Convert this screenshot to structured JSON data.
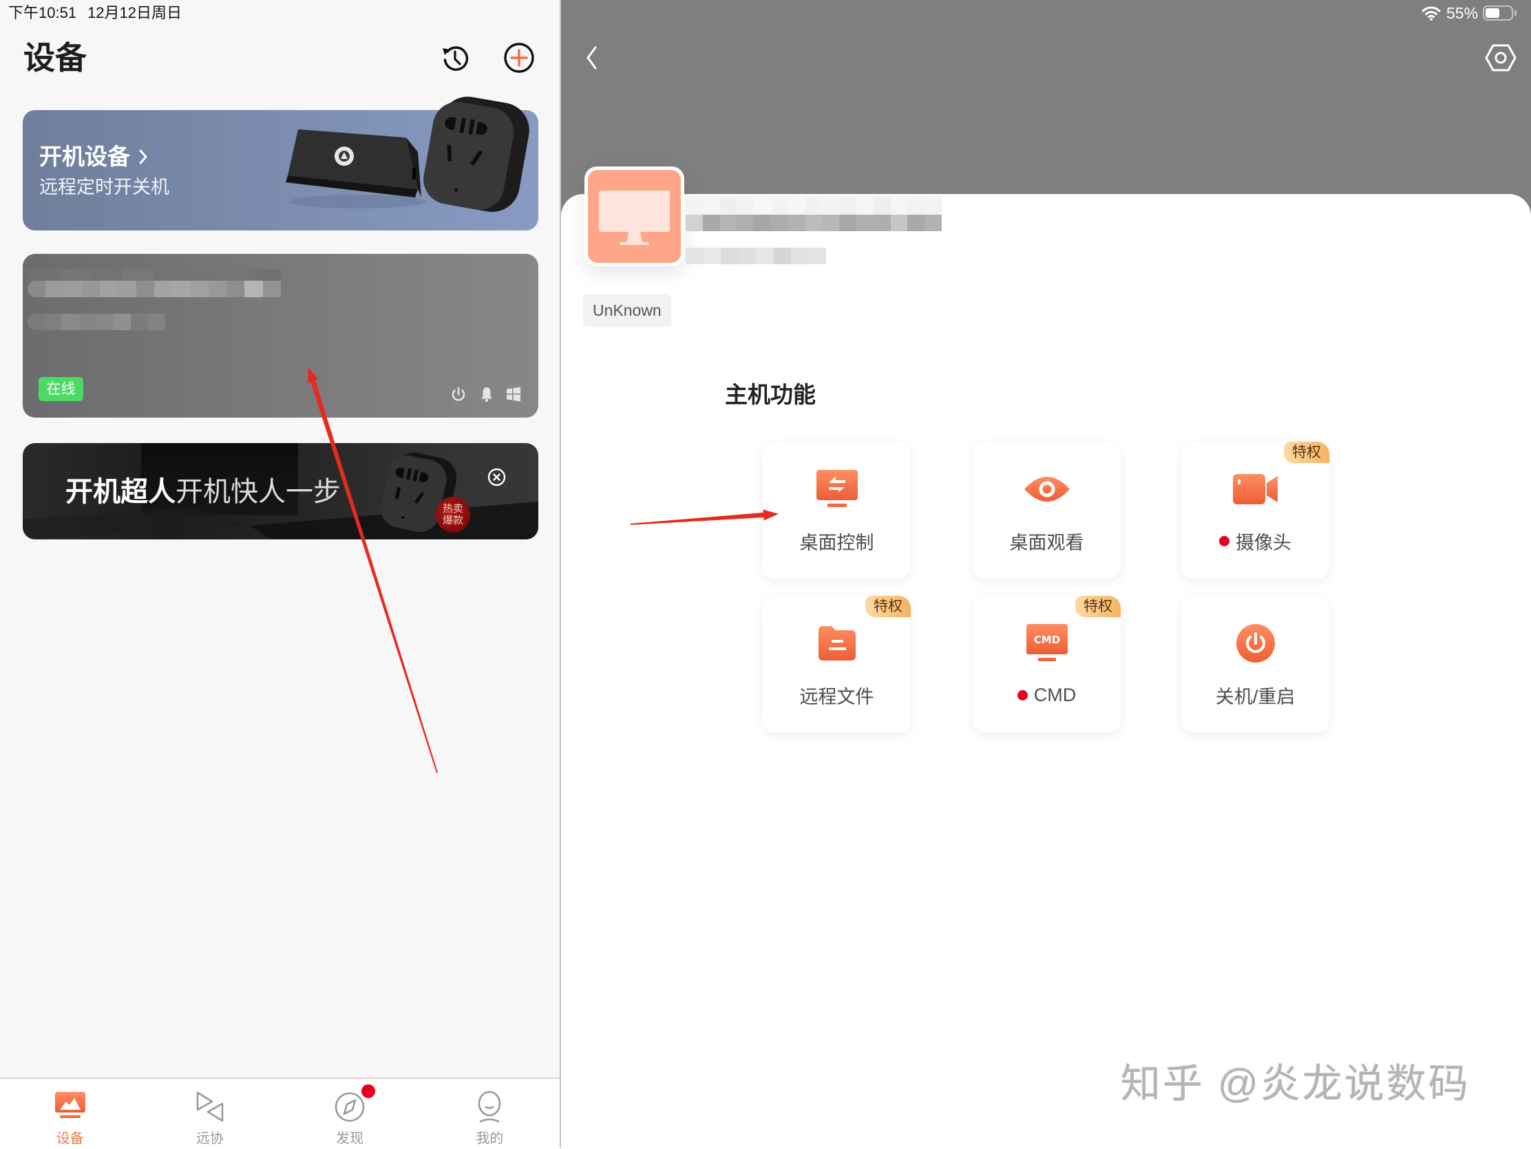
{
  "status_bar": {
    "time": "下午10:51",
    "date": "12月12日周日",
    "battery_text": "55%",
    "battery_level": 0.55
  },
  "devices_page": {
    "title": "设备",
    "banner": {
      "title": "开机设备",
      "subtitle": "远程定时开关机"
    },
    "device_card": {
      "status": "在线",
      "actions": [
        "power-icon",
        "bell-icon",
        "windows-icon"
      ]
    },
    "ad": {
      "title_bold": "开机超人",
      "title_light": "开机快人一步",
      "badge": [
        "热卖",
        "爆款"
      ]
    }
  },
  "tab_bar": {
    "tabs": [
      {
        "label": "设备",
        "icon": "device-icon",
        "active": true
      },
      {
        "label": "远协",
        "icon": "remote-assist-icon",
        "active": false
      },
      {
        "label": "发现",
        "icon": "compass-icon",
        "active": false,
        "has_badge": true
      },
      {
        "label": "我的",
        "icon": "profile-icon",
        "active": false
      }
    ]
  },
  "device_detail": {
    "os_tag": "UnKnown",
    "section_title": "主机功能",
    "privilege_label": "特权",
    "functions": [
      {
        "label": "桌面控制",
        "icon": "desktop-control-icon",
        "privileged": false,
        "dot": false
      },
      {
        "label": "桌面观看",
        "icon": "eye-icon",
        "privileged": false,
        "dot": false
      },
      {
        "label": "摄像头",
        "icon": "video-camera-icon",
        "privileged": true,
        "dot": true
      },
      {
        "label": "远程文件",
        "icon": "folder-icon",
        "privileged": true,
        "dot": false
      },
      {
        "label": "CMD",
        "icon": "cmd-icon",
        "icon_text": "CMD",
        "privileged": true,
        "dot": true
      },
      {
        "label": "关机/重启",
        "icon": "power-icon",
        "privileged": false,
        "dot": false
      }
    ]
  },
  "watermark": "知乎 @炎龙说数码",
  "colors": {
    "accent": "#F26B43",
    "header_gray": "#7F7F7F",
    "alert_dot": "#E8001C",
    "online_green": "#4CD964",
    "tab_active": "#F07A50",
    "tab_inactive": "#999999",
    "privilege_from": "#FDDBA4",
    "privilege_to": "#F6B262"
  }
}
